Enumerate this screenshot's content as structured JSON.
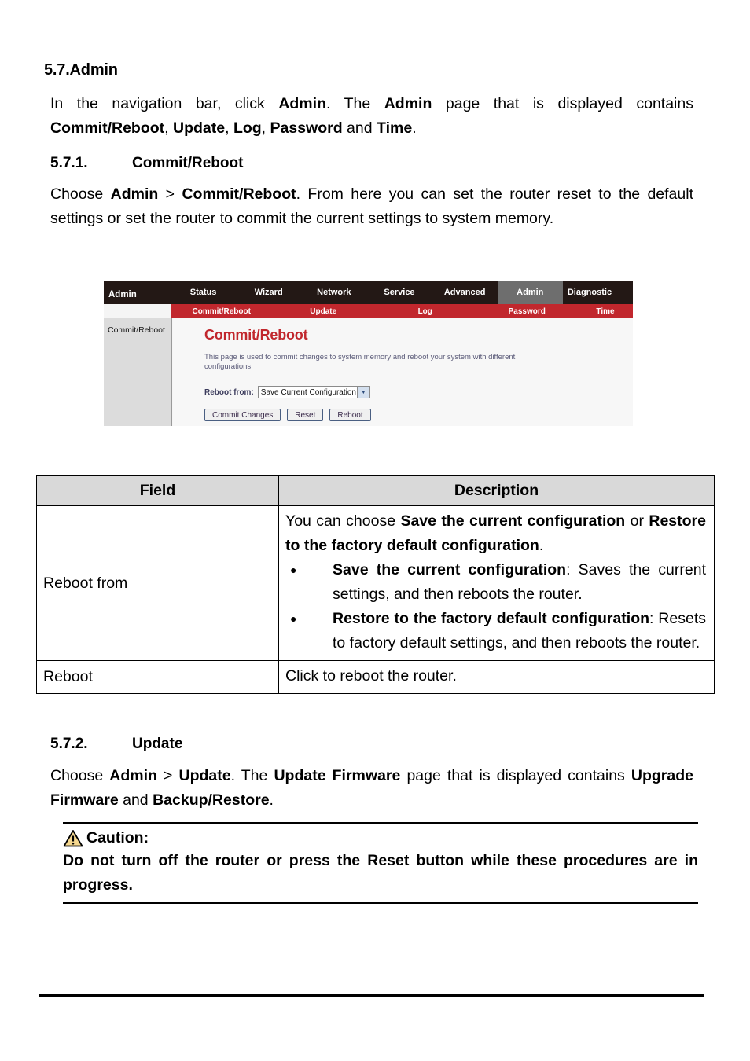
{
  "document": {
    "section_heading": "5.7.Admin",
    "intro_paragraph": {
      "t1": "In the navigation bar, click ",
      "b1": "Admin",
      "t2": ". The ",
      "b2": "Admin",
      "t3": " page that is displayed contains ",
      "b3": "Commit/Reboot",
      "t4": ", ",
      "b4": "Update",
      "t5": ", ",
      "b5": "Log",
      "t6": ", ",
      "b6": "Password",
      "t7": " and ",
      "b7": "Time",
      "t8": "."
    },
    "subsection_1": {
      "number": "5.7.1.",
      "title": "Commit/Reboot",
      "paragraph": {
        "t1": "Choose ",
        "b1": "Admin",
        "t2": " > ",
        "b2": "Commit/Reboot",
        "t3": ". From here you can set the router reset to the default settings or set the router to commit the current settings to system memory."
      }
    },
    "subsection_2": {
      "number": "5.7.2.",
      "title": "Update",
      "paragraph": {
        "t1": "Choose ",
        "b1": "Admin",
        "t2": " > ",
        "b2": "Update",
        "t3": ". The ",
        "b3": "Update Firmware",
        "t4": " page that is displayed contains ",
        "b4": "Upgrade Firmware",
        "t5": " and ",
        "b5": "Backup/Restore",
        "t6": "."
      }
    },
    "caution": {
      "icon": "warning-triangle-icon",
      "label": "Caution:",
      "body": "Do not turn off the router or press the Reset button while these procedures are in progress.",
      "icon_fill": "#F5D78E",
      "icon_stroke": "#000000"
    }
  },
  "screenshot": {
    "brand": "Admin",
    "nav_tabs": [
      {
        "label": "Status",
        "active": false
      },
      {
        "label": "Wizard",
        "active": false
      },
      {
        "label": "Network",
        "active": false
      },
      {
        "label": "Service",
        "active": false
      },
      {
        "label": "Advanced",
        "active": false
      },
      {
        "label": "Admin",
        "active": true
      },
      {
        "label": "Diagnostic",
        "active": false
      }
    ],
    "sub_tabs": [
      "Commit/Reboot",
      "Update",
      "Log",
      "Password",
      "Time"
    ],
    "sidebar_items": [
      "Commit/Reboot"
    ],
    "content": {
      "title": "Commit/Reboot",
      "description": "This page is used to commit changes to system memory and reboot your system with different configurations.",
      "form_label": "Reboot from:",
      "select_value": "Save Current Configuration",
      "select_arrow_icon": "chevron-down-icon",
      "buttons": [
        "Commit Changes",
        "Reset",
        "Reboot"
      ]
    },
    "colors": {
      "nav_bg": "#231815",
      "nav_active_bg": "#6E6E6E",
      "subnav_bg": "#C1272D",
      "title_red": "#C1272D",
      "sidebar_bg": "#DCDCDC"
    }
  },
  "table": {
    "headers": [
      "Field",
      "Description"
    ],
    "rows": [
      {
        "field": "Reboot from",
        "desc_intro": {
          "t1": "You can choose ",
          "b1": "Save the current configuration",
          "t2": " or ",
          "b2": "Restore to the factory default configuration",
          "t3": "."
        },
        "bullets": [
          {
            "bold": "Save the current configuration",
            "rest": ": Saves the current settings, and then reboots the router."
          },
          {
            "bold": "Restore to the factory default configuration",
            "rest": ": Resets to factory default settings, and then reboots the router."
          }
        ]
      },
      {
        "field": "Reboot",
        "desc_plain": "Click to reboot the router."
      }
    ]
  }
}
